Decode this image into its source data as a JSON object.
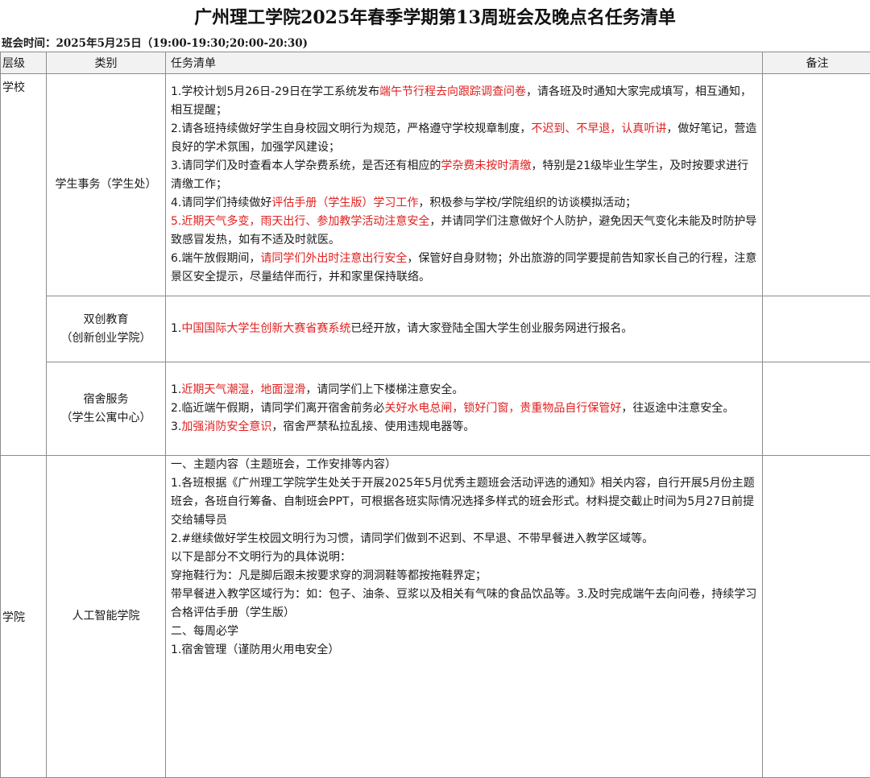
{
  "title": "广州理工学院2025年春季学期第13周班会及晚点名任务清单",
  "meeting_time": "班会时间：2025年5月25日（19:00-19:30;20:00-20:30)",
  "headers": {
    "level": "层级",
    "category": "类别",
    "tasks": "任务清单",
    "notes": "备注"
  },
  "groups": {
    "school": {
      "level": "学校",
      "student_affairs": {
        "category": "学生事务（学生处）",
        "t1": {
          "a": "1.学校计划5月26日-29日在学工系统发布",
          "b": "端午节行程去向跟踪调查问卷",
          "c": "，请各班及时通知大家完成填写，相互通知，相互提醒；"
        },
        "t2": {
          "a": "2.请各班持续做好学生自身校园文明行为规范，严格遵守学校规章制度，",
          "b": "不迟到、不早退，认真听讲",
          "c": "，做好笔记，营造良好的学术氛围，加强学风建设；"
        },
        "t3": {
          "a": "3.请同学们及时查看本人学杂费系统，是否还有相应的",
          "b": "学杂费未按时清缴",
          "c": "，特别是21级毕业生学生，及时按要求进行清缴工作；"
        },
        "t4": {
          "a": "4.请同学们持续做好",
          "b": "评估手册（学生版）学习工作",
          "c": "，积极参与学校/学院组织的访谈模拟活动；"
        },
        "t5": {
          "b": "5.近期天气多变，雨天出行、参加教学活动注意安全",
          "c": "，并请同学们注意做好个人防护，避免因天气变化未能及时防护导致感冒发热，如有不适及时就医。"
        },
        "t6": {
          "a": "6.端午放假期间，",
          "b": "请同学们外出时注意出行安全",
          "c": "，保管好自身财物；外出旅游的同学要提前告知家长自己的行程，注意景区安全提示，尽量结伴而行，并和家里保持联络。"
        }
      },
      "innovation": {
        "category_line1": "双创教育",
        "category_line2": "（创新创业学院）",
        "t1": {
          "a": "1.",
          "b": "中国国际大学生创新大赛省赛系统",
          "c": "已经开放，请大家登陆全国大学生创业服务网进行报名。"
        }
      },
      "dorm": {
        "category_line1": "宿舍服务",
        "category_line2": "（学生公寓中心）",
        "t1": {
          "a": "1.",
          "b": "近期天气潮湿，地面湿滑",
          "c": "，请同学们上下楼梯注意安全。"
        },
        "t2": {
          "a": "2.临近端午假期，请同学们离开宿舍前务必",
          "b": "关好水电总闸，锁好门窗，贵重物品自行保管好",
          "c": "，往返途中注意安全。"
        },
        "t3": {
          "a": "3.",
          "b": "加强消防安全意识",
          "c": "，宿舍严禁私拉乱接、使用违规电器等。"
        }
      }
    },
    "college": {
      "level": "学院",
      "ai": {
        "category": "人工智能学院",
        "lines": [
          "一、主题内容（主题班会，工作安排等内容）",
          "1.各班根据《广州理工学院学生处关于开展2025年5月优秀主题班会活动评选的通知》相关内容，自行开展5月份主题班会，各班自行筹备、自制班会PPT，可根据各班实际情况选择多样式的班会形式。材料提交截止时间为5月27日前提交给辅导员",
          "2.#继续做好学生校园文明行为习惯，请同学们做到不迟到、不早退、不带早餐进入教学区域等。",
          "以下是部分不文明行为的具体说明：",
          "穿拖鞋行为：凡是脚后跟未按要求穿的洞洞鞋等都按拖鞋界定；",
          "带早餐进入教学区域行为：如：包子、油条、豆浆以及相关有气味的食品饮品等。3.及时完成端午去向问卷，持续学习合格评估手册（学生版）",
          "二、每周必学",
          "1.宿舍管理（谨防用火用电安全）"
        ]
      }
    }
  }
}
